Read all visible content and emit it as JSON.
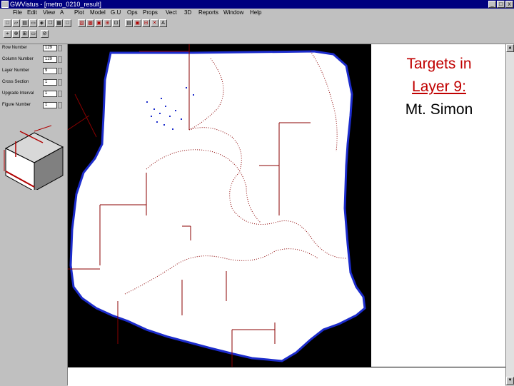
{
  "window": {
    "title": "GWVistus - [metro_0210_result]",
    "min_label": "_",
    "max_label": "□",
    "close_label": "x"
  },
  "menu": [
    "File",
    "Edit",
    "View",
    "A",
    "Plot",
    "Model",
    "G.U",
    "Ops",
    "Props",
    "Vect",
    "3D",
    "Reports",
    "Window",
    "Help"
  ],
  "toolbar": {
    "row1": [
      "□",
      "▱",
      "▤",
      "▭",
      "◈",
      "☐",
      "▦",
      "□",
      "▧",
      "▩",
      "▣",
      "⊞",
      "⊡",
      "▤",
      "▣",
      "⊟",
      "✕",
      "✕",
      "▥",
      "✎",
      "⊠",
      "⊡",
      "▦",
      "◫",
      "▢",
      "A"
    ],
    "row2": [
      "⌖",
      "⊕",
      "⊞",
      "▭",
      "⊘"
    ]
  },
  "fields": [
    {
      "label": "Row Number",
      "value": "129"
    },
    {
      "label": "Column Number",
      "value": "129"
    },
    {
      "label": "Layer Number",
      "value": "9"
    },
    {
      "label": "Cross Section",
      "value": "1"
    },
    {
      "label": "Upgrade Interval",
      "value": "1"
    },
    {
      "label": "Figure Number",
      "value": "1"
    }
  ],
  "slide": {
    "heading_line1": "Targets in",
    "heading_line2": "Layer 9:",
    "heading_line3": "Mt. Simon"
  },
  "colors": {
    "title_bar": "#00007f",
    "heading_red": "#c00000",
    "model_boundary": "#1c2ccc",
    "grid_lines": "#8b0000"
  }
}
